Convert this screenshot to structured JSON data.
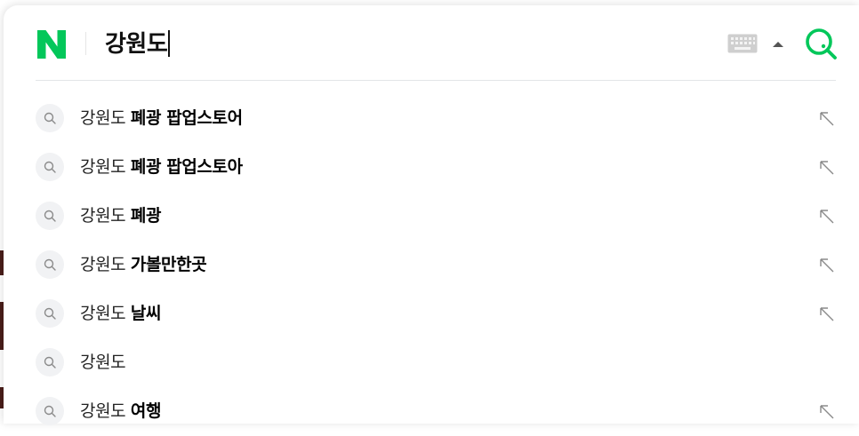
{
  "search": {
    "query": "강원도",
    "logo_letter": "N"
  },
  "suggestions": [
    {
      "prefix": "강원도",
      "rest": "폐광 팝업스토어",
      "has_fill": true
    },
    {
      "prefix": "강원도",
      "rest": "폐광 팝업스토아",
      "has_fill": true
    },
    {
      "prefix": "강원도",
      "rest": "폐광",
      "has_fill": true
    },
    {
      "prefix": "강원도",
      "rest": "가볼만한곳",
      "has_fill": true
    },
    {
      "prefix": "강원도",
      "rest": "날씨",
      "has_fill": true
    },
    {
      "prefix": "강원도",
      "rest": "",
      "has_fill": false
    },
    {
      "prefix": "강원도",
      "rest": "여행",
      "has_fill": true
    }
  ],
  "colors": {
    "brand_green": "#03c75a",
    "icon_gray": "#9a9a9a",
    "divider": "#e3e5e8"
  },
  "icons": {
    "logo": "naver-n-logo",
    "keyboard": "keyboard-icon",
    "expand": "caret-up-icon",
    "search": "search-icon",
    "suggestion": "magnifier-icon",
    "fill": "arrow-up-left-icon"
  }
}
